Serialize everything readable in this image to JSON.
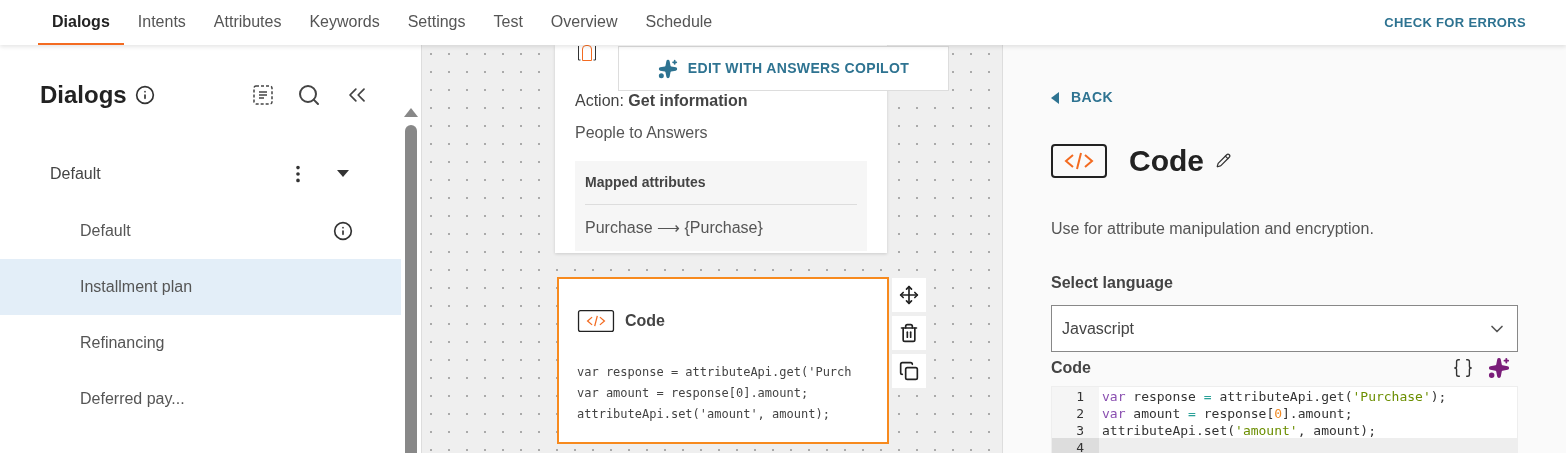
{
  "tabs": [
    {
      "label": "Dialogs",
      "selected": true
    },
    {
      "label": "Intents",
      "selected": false
    },
    {
      "label": "Attributes",
      "selected": false
    },
    {
      "label": "Keywords",
      "selected": false
    },
    {
      "label": "Settings",
      "selected": false
    },
    {
      "label": "Test",
      "selected": false
    },
    {
      "label": "Overview",
      "selected": false
    },
    {
      "label": "Schedule",
      "selected": false
    }
  ],
  "check_errors": "CHECK FOR ERRORS",
  "sidebar": {
    "title": "Dialogs",
    "group": {
      "label": "Default",
      "expanded": true,
      "children": [
        {
          "label": "Default",
          "selected": false,
          "info": true
        },
        {
          "label": "Installment plan",
          "selected": true,
          "info": false
        },
        {
          "label": "Refinancing",
          "selected": false,
          "info": false
        },
        {
          "label": "Deferred pay...",
          "selected": false,
          "info": false
        }
      ]
    }
  },
  "canvas": {
    "copilot_button": "EDIT WITH ANSWERS COPILOT",
    "action_card": {
      "action": "Action: **Get information**",
      "subtitle": "People to Answers",
      "mapped_title": "Mapped attributes",
      "mapped_row": "Purchase ⟶ {Purchase}"
    },
    "code_card": {
      "title": "Code",
      "selected": true,
      "lines": [
        "var response = attributeApi.get('Purch",
        "var amount = response[0].amount;",
        "attributeApi.set('amount', amount);"
      ]
    }
  },
  "panel": {
    "back": "BACK",
    "title": "Code",
    "description": "Use for attribute manipulation and encryption.",
    "language_label": "Select language",
    "language_value": "Javascript",
    "code_label": "Code",
    "editor": [
      {
        "number": "1",
        "active": false,
        "tokens": [
          {
            "kind": "keyword",
            "text": "var"
          },
          {
            "kind": "plain",
            "text": " response "
          },
          {
            "kind": "operator",
            "text": "="
          },
          {
            "kind": "plain",
            "text": " attributeApi.get("
          },
          {
            "kind": "string",
            "text": "'Purchase'"
          },
          {
            "kind": "plain",
            "text": ");"
          }
        ]
      },
      {
        "number": "2",
        "active": false,
        "tokens": [
          {
            "kind": "keyword",
            "text": "var"
          },
          {
            "kind": "plain",
            "text": " amount "
          },
          {
            "kind": "operator",
            "text": "="
          },
          {
            "kind": "plain",
            "text": " response["
          },
          {
            "kind": "number",
            "text": "0"
          },
          {
            "kind": "plain",
            "text": "].amount;"
          }
        ]
      },
      {
        "number": "3",
        "active": false,
        "tokens": [
          {
            "kind": "plain",
            "text": "attributeApi.set("
          },
          {
            "kind": "string",
            "text": "'amount'"
          },
          {
            "kind": "plain",
            "text": ", amount);"
          }
        ]
      },
      {
        "number": "4",
        "active": true
      }
    ]
  }
}
